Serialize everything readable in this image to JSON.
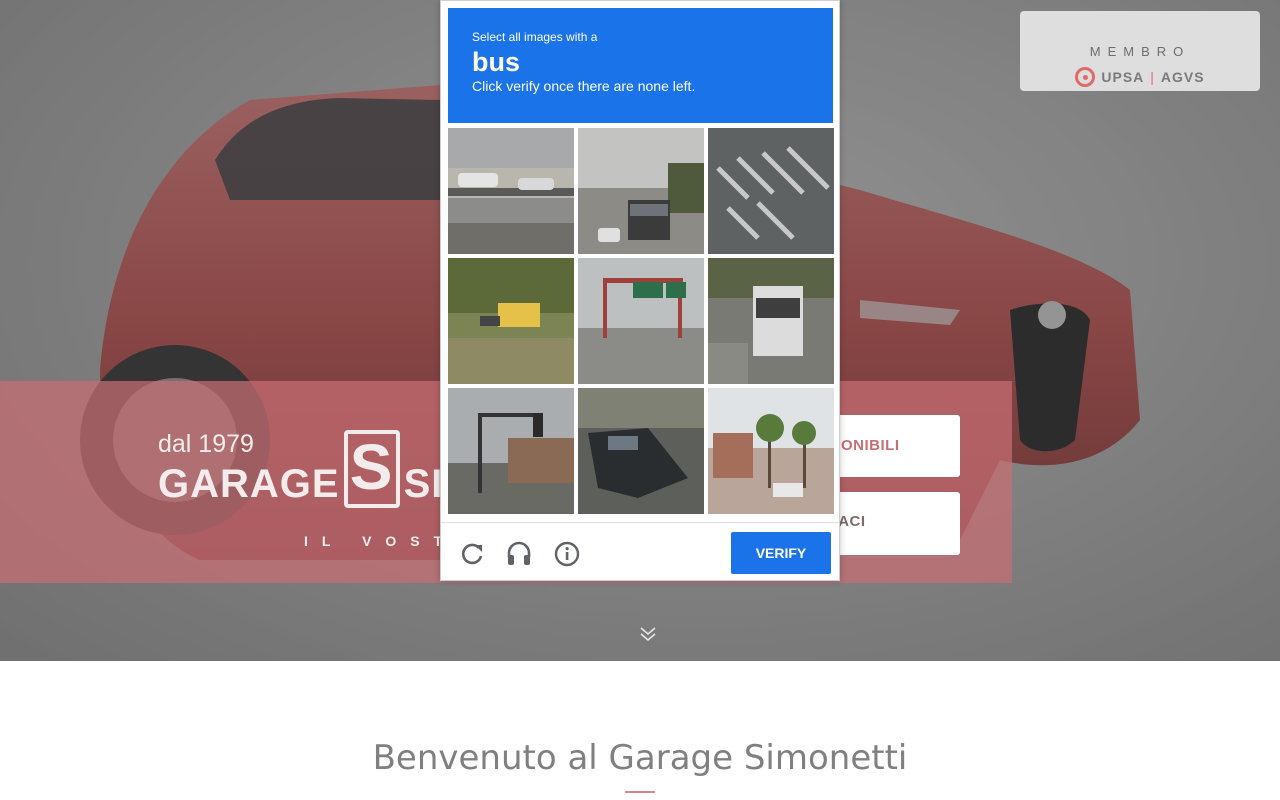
{
  "member": {
    "title": "MEMBRO",
    "org_left": "UPSA",
    "org_sep": "|",
    "org_right": "AGVS"
  },
  "hero": {
    "since": "dal 1979",
    "brand_left": "GARAGE",
    "brand_mark": "S",
    "brand_right": "SIMO",
    "tagline": "IL VOSTR",
    "cta_primary": "SPONIBILI",
    "cta_secondary": "TTACI"
  },
  "welcome": {
    "title": "Benvenuto al Garage Simonetti"
  },
  "captcha": {
    "instruction_small": "Select all images with a",
    "target_word": "bus",
    "instruction_bottom": "Click verify once there are none left.",
    "verify_label": "VERIFY",
    "tiles": [
      "highway-overpass",
      "highway-bus",
      "crosswalk",
      "school-bus",
      "highway-sign-gantry",
      "city-bus",
      "traffic-light",
      "parked-car",
      "palm-trees"
    ]
  },
  "icons": {
    "reload": "reload-icon",
    "audio": "headphones-icon",
    "info": "info-icon",
    "scroll": "chevron-double-down-icon",
    "member_logo": "upsa-logo-icon"
  },
  "colors": {
    "accent": "#1a73e8",
    "brand_pink": "#c56f75",
    "band": "#c86e73"
  }
}
